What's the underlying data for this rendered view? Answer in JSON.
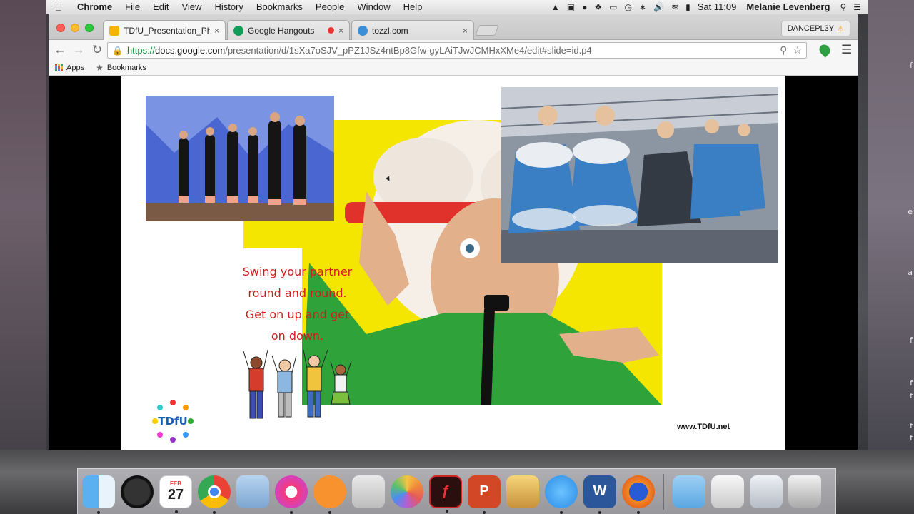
{
  "menubar": {
    "app_name": "Chrome",
    "menus": [
      "File",
      "Edit",
      "View",
      "History",
      "Bookmarks",
      "People",
      "Window",
      "Help"
    ],
    "clock": "Sat 11:09",
    "user": "Melanie Levenberg"
  },
  "tabs": [
    {
      "title": "TDfU_Presentation_Physe",
      "close": "×"
    },
    {
      "title": "Google Hangouts",
      "close": "×"
    },
    {
      "title": "tozzl.com",
      "close": "×"
    }
  ],
  "profile": {
    "name": "DANCEPL3Y"
  },
  "omnibox": {
    "scheme": "https://",
    "host": "docs.google.com",
    "path": "/presentation/d/1sXa7oSJV_pPZ1JSz4ntBp8Gfw-gyLAiTJwJCMHxXMe4/edit#slide=id.p4"
  },
  "bookmarks": {
    "apps_label": "Apps",
    "bookmarks_label": "Bookmarks"
  },
  "slide": {
    "quote_lines": [
      "Swing your partner",
      "round and round.",
      "Get on up and get",
      "on down."
    ],
    "logo_text": "TDfU",
    "website": "www.TDfU.net"
  },
  "wallpaper_fragments": [
    "f",
    "a",
    "e",
    "f",
    "f",
    "f",
    "f",
    "f"
  ],
  "dock": {
    "calendar_month": "FEB",
    "calendar_day": "27",
    "apps": [
      "finder-icon",
      "dashboard-icon",
      "calendar-icon",
      "chrome-icon",
      "preview-icon",
      "itunes-icon",
      "ibooks-icon",
      "image-capture-icon",
      "photos-icon",
      "acrobat-icon",
      "powerpoint-icon",
      "painting-icon",
      "messages-icon",
      "word-icon",
      "firefox-icon",
      "applications-folder-icon",
      "documents-stack-icon",
      "downloads-stack-icon",
      "trash-icon"
    ]
  },
  "colors": {
    "quote_red": "#d21c1c",
    "slide_yellow": "#f4e600",
    "url_green": "#0b8f3a"
  }
}
